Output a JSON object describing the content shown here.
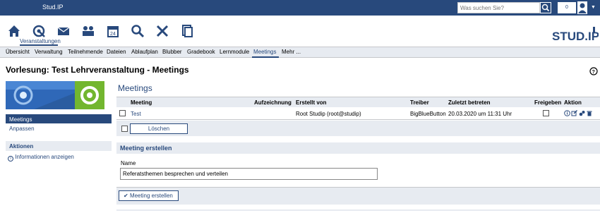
{
  "topbar": {
    "brand": "Stud.IP",
    "search_placeholder": "Was suchen Sie?",
    "notification_count": "0"
  },
  "nav": {
    "active_label": "Veranstaltungen"
  },
  "tabs": [
    "Übersicht",
    "Verwaltung",
    "Teilnehmende",
    "Dateien",
    "Ablaufplan",
    "Blubber",
    "Gradebook",
    "Lernmodule",
    "Meetings",
    "Mehr ..."
  ],
  "page_title": "Vorlesung: Test Lehrveranstaltung - Meetings",
  "sidebar": {
    "items": [
      "Meetings",
      "Anpassen"
    ],
    "actions_title": "Aktionen",
    "action_info": "Informationen anzeigen"
  },
  "meetings": {
    "title": "Meetings",
    "columns": [
      "Meeting",
      "Aufzeichnung",
      "Erstellt von",
      "Treiber",
      "Zuletzt betreten",
      "Freigeben",
      "Aktion"
    ],
    "rows": [
      {
        "meeting": "Test",
        "aufzeichnung": "",
        "erstellt_von": "Root Studip (root@studip)",
        "treiber": "BigBlueButton",
        "zuletzt_betreten": "20.03.2020 um 11:31 Uhr"
      }
    ],
    "delete_label": "Löschen"
  },
  "create": {
    "title": "Meeting erstellen",
    "name_label": "Name",
    "name_value": "Referatsthemen besprechen und verteilen",
    "submit_label": "Meeting erstellen"
  },
  "colors": {
    "primary": "#28497c",
    "light": "#e7ebf1"
  }
}
